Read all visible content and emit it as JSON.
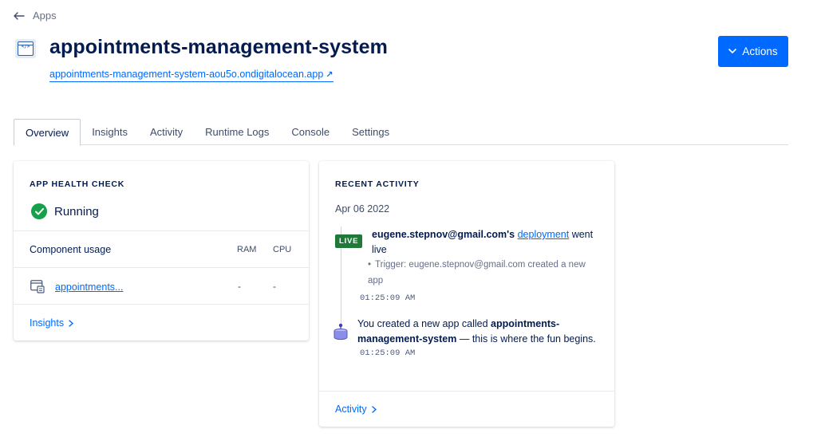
{
  "nav": {
    "back_label": "Apps"
  },
  "app": {
    "name": "appointments-management-system",
    "live_url": "appointments-management-system-aou5o.ondigitalocean.app",
    "url_arrow": "↗",
    "actions_label": "Actions"
  },
  "tabs": [
    {
      "label": "Overview",
      "active": true
    },
    {
      "label": "Insights",
      "active": false
    },
    {
      "label": "Activity",
      "active": false
    },
    {
      "label": "Runtime Logs",
      "active": false
    },
    {
      "label": "Console",
      "active": false
    },
    {
      "label": "Settings",
      "active": false
    }
  ],
  "health": {
    "heading": "APP HEALTH CHECK",
    "status": "Running",
    "component_header": "Component usage",
    "ram_header": "RAM",
    "cpu_header": "CPU",
    "components": [
      {
        "name": "appointments...",
        "ram": "-",
        "cpu": "-"
      }
    ],
    "more_link": "Insights"
  },
  "activity": {
    "heading": "RECENT ACTIVITY",
    "date": "Apr 06 2022",
    "events": [
      {
        "badge": "LIVE",
        "actor": "eugene.stepnov@gmail.com's",
        "link": "deployment",
        "suffix": "went live",
        "trigger": "Trigger: eugene.stepnov@gmail.com created a new app",
        "time": "01:25:09 AM"
      },
      {
        "prefix": "You created a new app called",
        "app_name": "appointments-management-system",
        "suffix": "— this is where the fun begins.",
        "time": "01:25:09 AM"
      }
    ],
    "more_link": "Activity"
  },
  "colors": {
    "accent": "#0069ff",
    "success": "#15a14a",
    "live_badge": "#1f7a3a",
    "text": "#031b4e"
  }
}
